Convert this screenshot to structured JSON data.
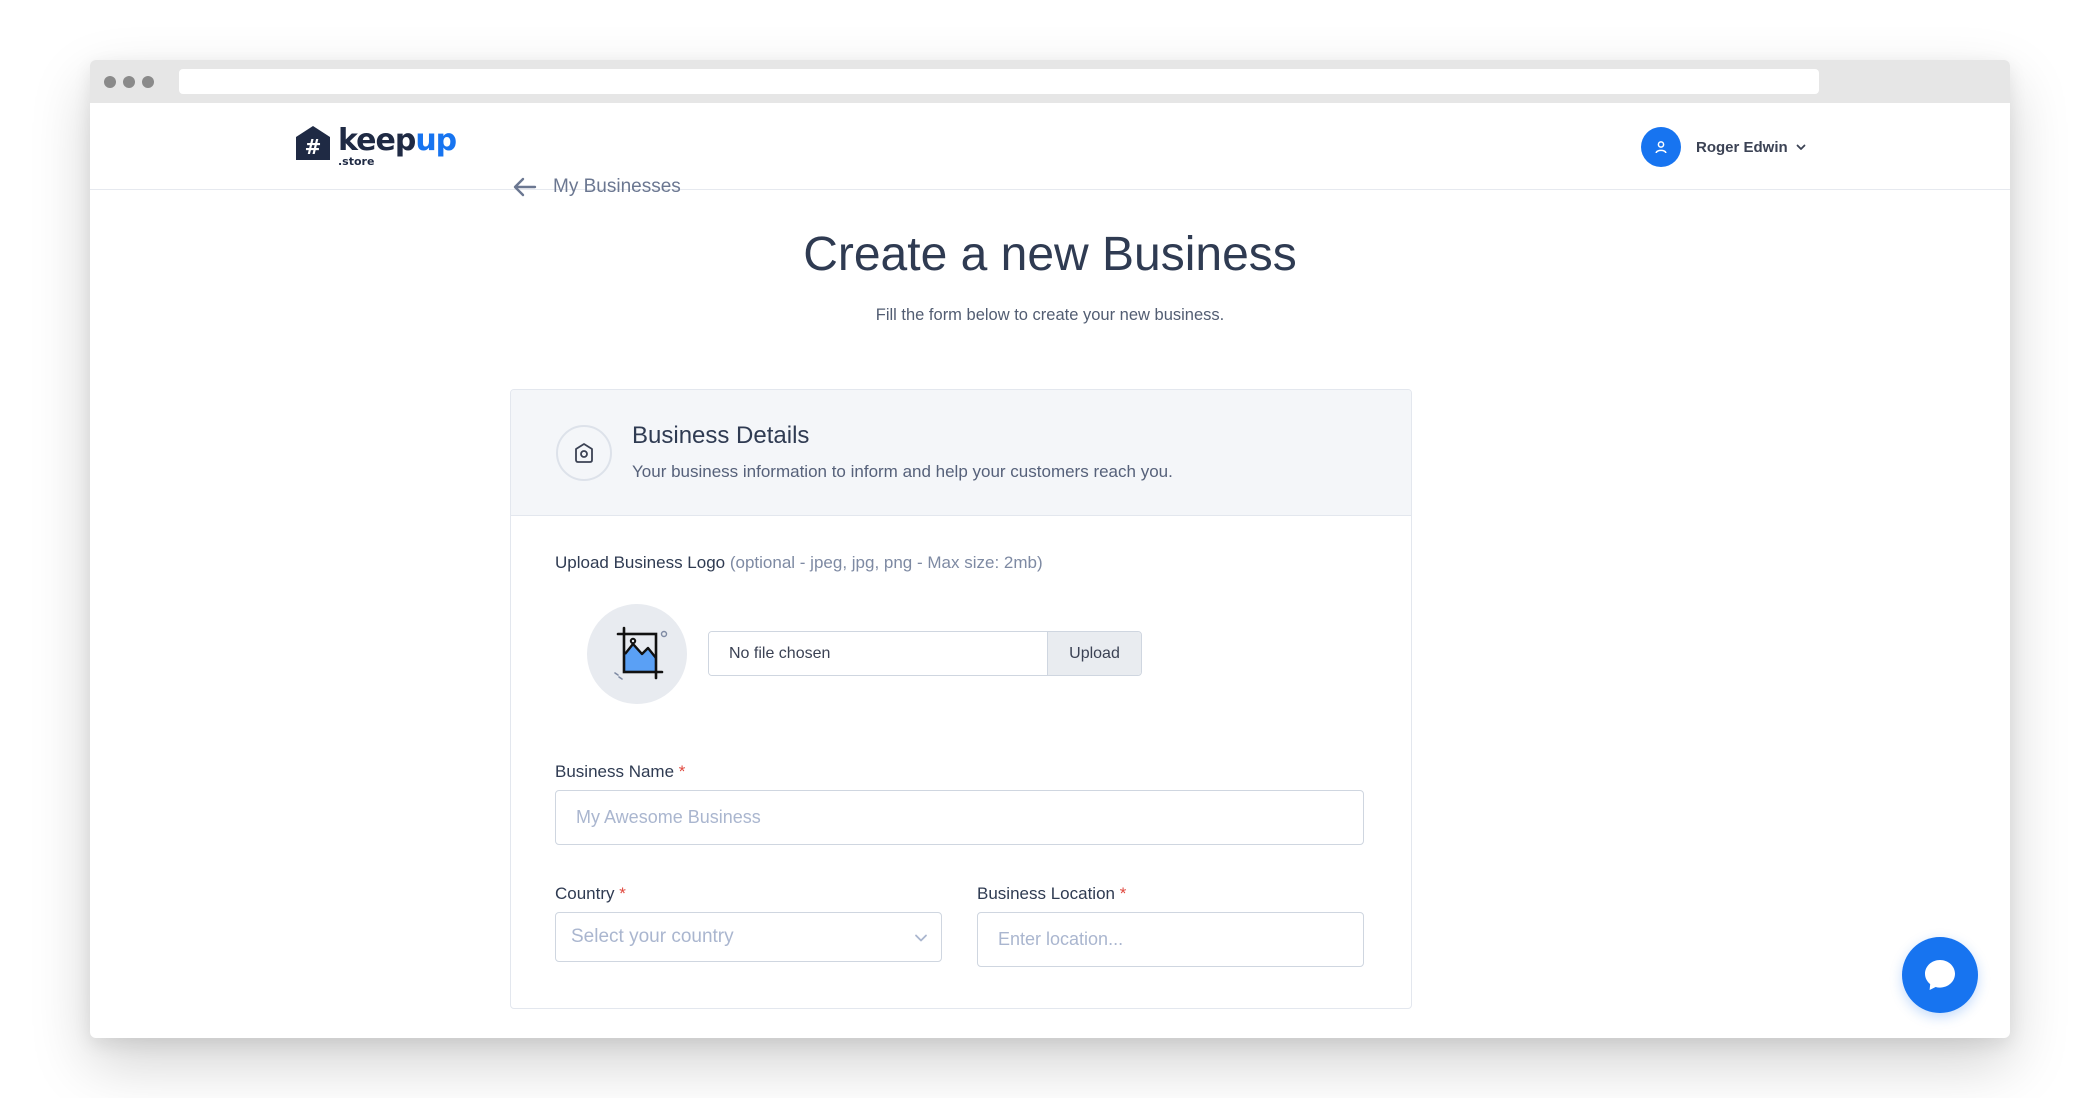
{
  "app": {
    "logo_word": "keep",
    "logo_word_accent": "up",
    "logo_sub": ".store"
  },
  "header": {
    "user_name": "Roger Edwin"
  },
  "nav": {
    "back_label": "My Businesses"
  },
  "page": {
    "title": "Create a new Business",
    "subtitle": "Fill the form below to create your new business."
  },
  "card": {
    "title": "Business Details",
    "description": "Your business information to inform and help your customers reach you."
  },
  "form": {
    "logo_label": "Upload Business Logo",
    "logo_hint": "(optional - jpeg, jpg, png - Max size: 2mb)",
    "file_status": "No file chosen",
    "upload_button": "Upload",
    "business_name_label": "Business Name",
    "business_name_placeholder": "My Awesome Business",
    "country_label": "Country",
    "country_placeholder": "Select your country",
    "location_label": "Business Location",
    "location_placeholder": "Enter location...",
    "required_mark": "*"
  },
  "colors": {
    "brand": "#1774f0",
    "brand_dark": "#1f2a44",
    "required": "#e0483e"
  },
  "icons": {
    "back": "arrow-left-icon",
    "user": "user-icon",
    "dropdown": "chevron-down-icon",
    "business": "store-icon",
    "image": "image-crop-icon",
    "chat": "chat-bubble-icon"
  }
}
